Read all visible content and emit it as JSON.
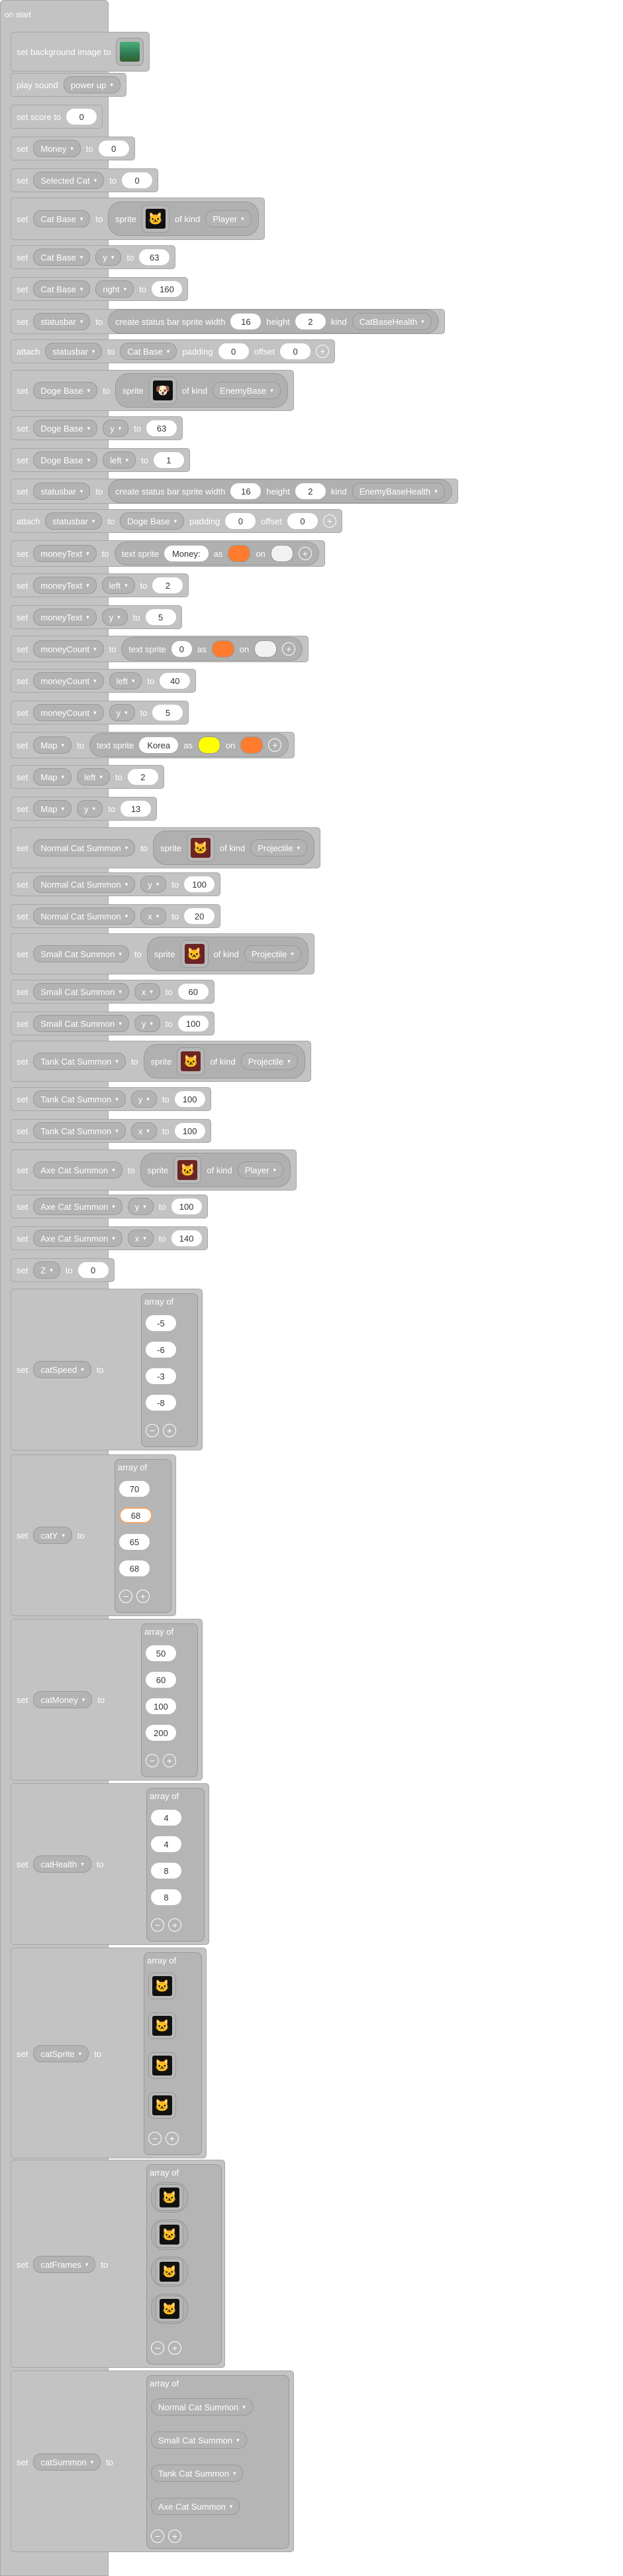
{
  "hat": {
    "label": "on start"
  },
  "kw": {
    "set": "set",
    "to": "to",
    "play_sound": "play sound",
    "attach": "attach",
    "sprite": "sprite",
    "of_kind": "of kind",
    "as": "as",
    "on": "on",
    "text_sprite": "text sprite",
    "create_sb": "create status bar sprite width",
    "height": "height",
    "kind": "kind",
    "padding": "padding",
    "offset": "offset",
    "array_of": "array of",
    "bg_label": "set background image to",
    "score_label": "set score to"
  },
  "blocks": {
    "sound": "power up",
    "score": "0",
    "money_var": "Money",
    "money_val": "0",
    "selcat_var": "Selected Cat",
    "selcat_val": "0",
    "catbase_var": "Cat Base",
    "catbase_kind": "Player",
    "catbase_y_prop": "y",
    "catbase_y_val": "63",
    "catbase_right_prop": "right",
    "catbase_right_val": "160",
    "sb1_var": "statusbar",
    "sb1_w": "16",
    "sb1_h": "2",
    "sb1_kind": "CatBaseHealth",
    "att1_var": "statusbar",
    "att1_target": "Cat Base",
    "att1_pad": "0",
    "att1_off": "0",
    "doge_var": "Doge Base",
    "doge_kind": "EnemyBase",
    "doge_y_prop": "y",
    "doge_y_val": "63",
    "doge_left_prop": "left",
    "doge_left_val": "1",
    "sb2_var": "statusbar",
    "sb2_w": "16",
    "sb2_h": "2",
    "sb2_kind": "EnemyBaseHealth",
    "att2_var": "statusbar",
    "att2_target": "Doge Base",
    "att2_pad": "0",
    "att2_off": "0",
    "mtext_var": "moneyText",
    "mtext_str": "Money:",
    "mtext_left_prop": "left",
    "mtext_left_val": "2",
    "mtext_y_prop": "y",
    "mtext_y_val": "5",
    "mcount_var": "moneyCount",
    "mcount_str": "0",
    "mcount_left_prop": "left",
    "mcount_left_val": "40",
    "mcount_y_prop": "y",
    "mcount_y_val": "5",
    "map_var": "Map",
    "map_str": "Korea",
    "map_left_prop": "left",
    "map_left_val": "2",
    "map_y_prop": "y",
    "map_y_val": "13",
    "ncs_var": "Normal Cat Summon",
    "ncs_kind": "Projectile",
    "ncs_y_prop": "y",
    "ncs_y_val": "100",
    "ncs_x_prop": "x",
    "ncs_x_val": "20",
    "scs_var": "Small Cat Summon",
    "scs_kind": "Projectile",
    "scs_x_prop": "x",
    "scs_x_val": "60",
    "scs_y_prop": "y",
    "scs_y_val": "100",
    "tcs_var": "Tank Cat Summon",
    "tcs_kind": "Projectile",
    "tcs_y_prop": "y",
    "tcs_y_val": "100",
    "tcs_x_prop": "x",
    "tcs_x_val": "100",
    "acs_var": "Axe Cat Summon",
    "acs_kind": "Player",
    "acs_y_prop": "y",
    "acs_y_val": "100",
    "acs_x_prop": "x",
    "acs_x_val": "140",
    "z_var": "Z",
    "z_val": "0"
  },
  "arrays": {
    "speed": {
      "var": "catSpeed",
      "items": [
        "-5",
        "-6",
        "-3",
        "-8"
      ]
    },
    "y": {
      "var": "catY",
      "items": [
        "70",
        "68",
        "65",
        "68"
      ]
    },
    "money": {
      "var": "catMoney",
      "items": [
        "50",
        "60",
        "100",
        "200"
      ]
    },
    "health": {
      "var": "catHealth",
      "items": [
        "4",
        "4",
        "8",
        "8"
      ]
    },
    "sprite": {
      "var": "catSprite"
    },
    "frames": {
      "var": "catFrames"
    },
    "summon": {
      "var": "catSummon",
      "items": [
        "Normal Cat Summon",
        "Small Cat Summon",
        "Tank Cat Summon",
        "Axe Cat Summon"
      ]
    }
  },
  "colors": {
    "orange": "#ff7b2e",
    "white": "#f2f2f2",
    "yellow": "#ffff00",
    "block": "#c3c3c3"
  },
  "icons": {
    "caret": "▾",
    "plus": "+",
    "minus": "−",
    "cat": "🐱",
    "dog": "🐶"
  }
}
